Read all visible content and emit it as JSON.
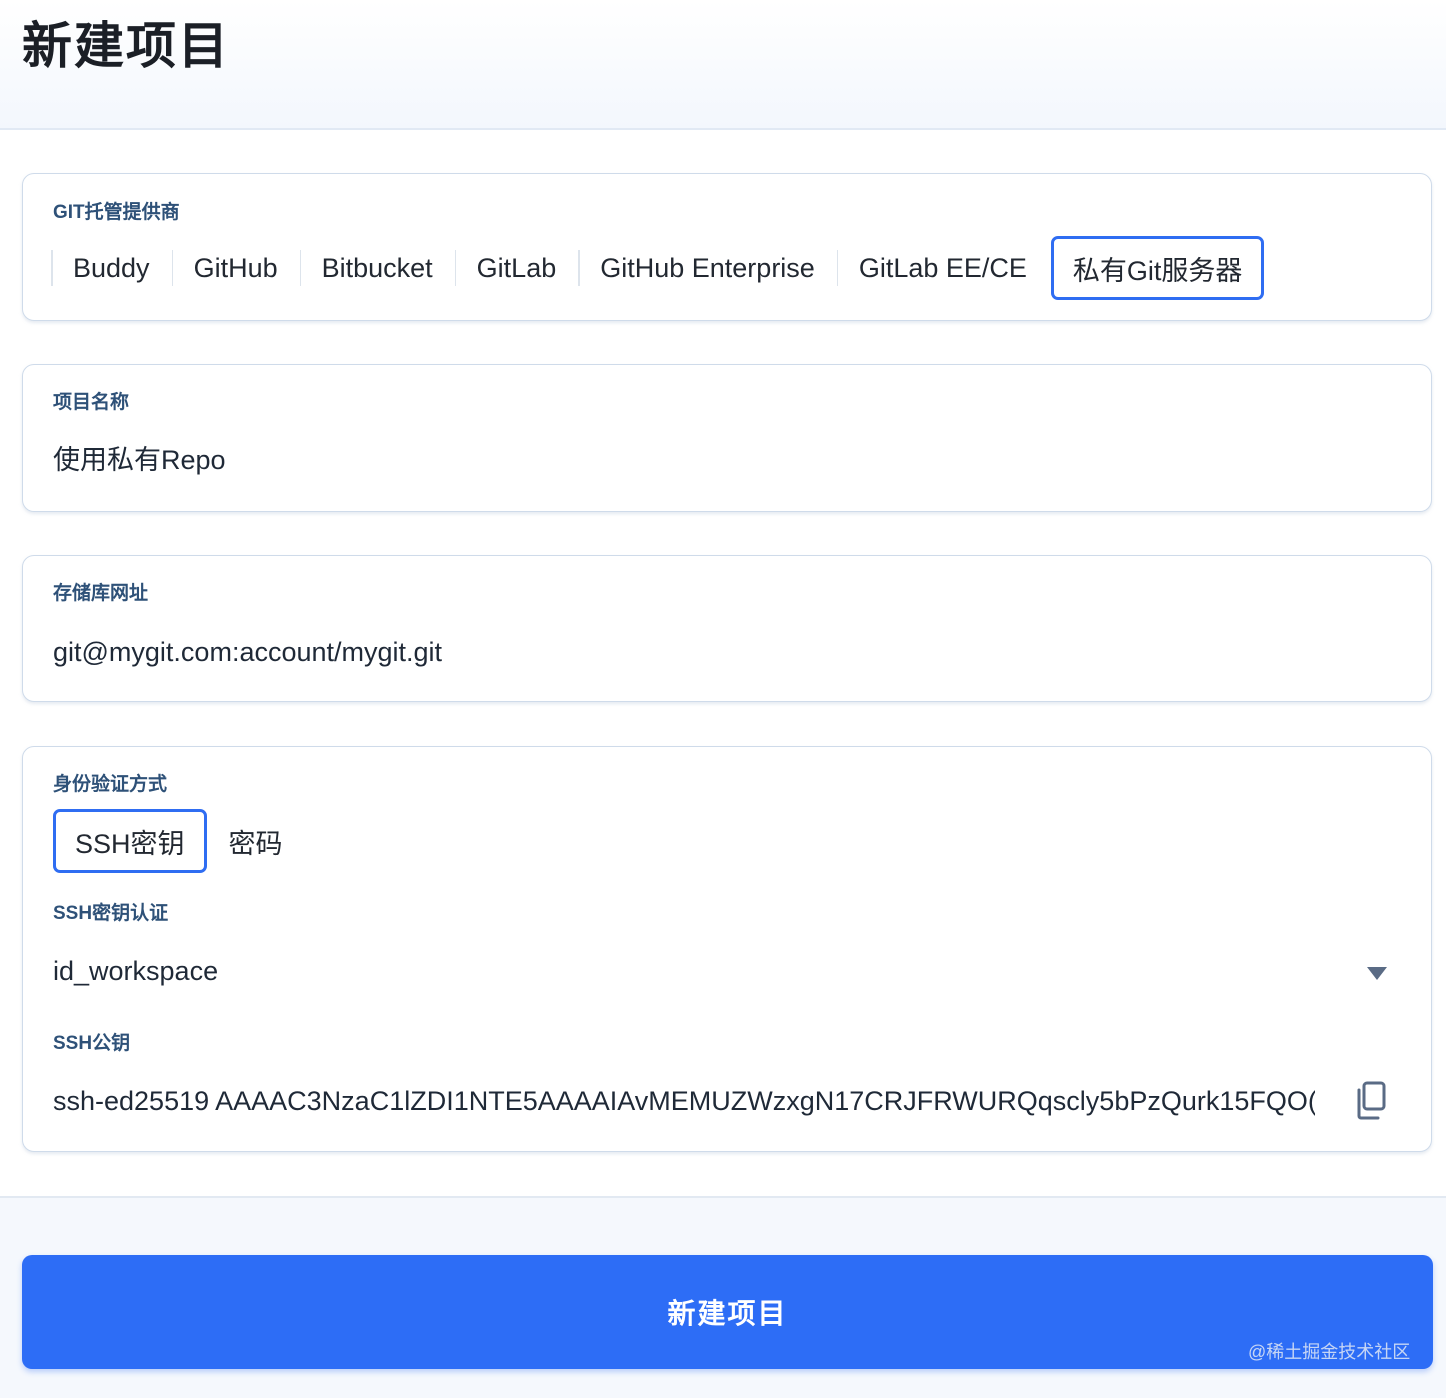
{
  "page": {
    "title": "新建项目"
  },
  "provider": {
    "label": "GIT托管提供商",
    "tabs": [
      "Buddy",
      "GitHub",
      "Bitbucket",
      "GitLab",
      "GitHub Enterprise",
      "GitLab EE/CE",
      "私有Git服务器"
    ],
    "selected": "私有Git服务器"
  },
  "project_name": {
    "label": "项目名称",
    "value": "使用私有Repo"
  },
  "repo_url": {
    "label": "存储库网址",
    "value": "git@mygit.com:account/mygit.git"
  },
  "auth": {
    "label": "身份验证方式",
    "tabs": [
      "SSH密钥",
      "密码"
    ],
    "selected": "SSH密钥",
    "ssh_key_label": "SSH密钥认证",
    "ssh_key_value": "id_workspace",
    "public_key_label": "SSH公钥",
    "public_key_value": "ssh-ed25519 AAAAC3NzaC1lZDI1NTE5AAAAIAvMEMUZWzxgN17CRJFRWURQqscly5bPzQurk15FQO(",
    "dropdown_icon": "chevron-down-icon",
    "copy_icon": "copy-icon"
  },
  "footer": {
    "create_button_label": "新建项目",
    "watermark": "@稀土掘金技术社区"
  },
  "colors": {
    "accent": "#2d6df6",
    "label": "#2e5178",
    "border": "#cfdbea"
  }
}
